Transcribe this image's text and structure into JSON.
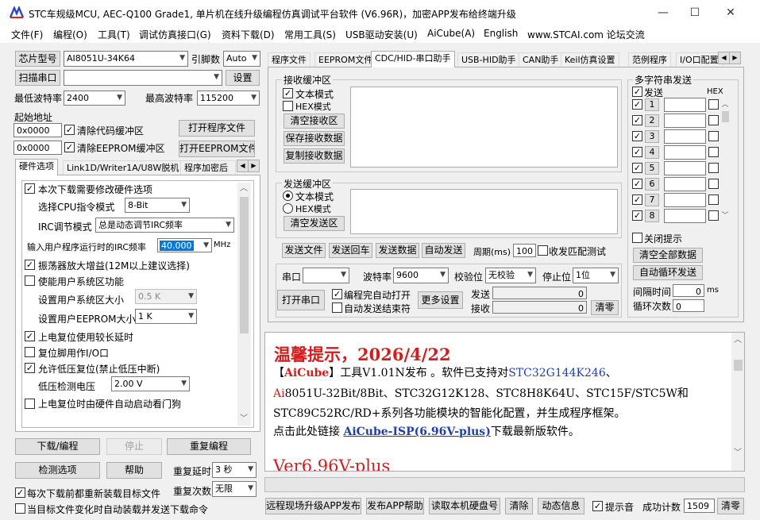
{
  "window": {
    "title": "STC车规级MCU, AEC-Q100 Grade1, 单片机在线升级编程仿真调试平台软件 (V6.96R)，加密APP发布给终端升级",
    "minimize": "—",
    "maximize": "☐",
    "close": "✕"
  },
  "menu": [
    "文件(F)",
    "编程(O)",
    "工具(T)",
    "调试仿真接口(G)",
    "资料下载(D)",
    "常用工具(S)",
    "USB驱动安装(U)",
    "AiCube(A)",
    "English",
    "www.STCAI.com 论坛交流"
  ],
  "left": {
    "chip_model_btn": "芯片型号",
    "chip_model_value": "AI8051U-34K64",
    "pin_count_label": "引脚数",
    "pin_count_value": "Auto",
    "scan_port_btn": "扫描串口",
    "port_value": "",
    "settings_btn": "设置",
    "min_baud_label": "最低波特率",
    "min_baud_value": "2400",
    "max_baud_label": "最高波特率",
    "max_baud_value": "115200",
    "start_addr_label": "起始地址",
    "addr1": "0x0000",
    "clear_code": "清除代码缓冲区",
    "open_prog": "打开程序文件",
    "addr2": "0x0000",
    "clear_eeprom": "清除EEPROM缓冲区",
    "open_eeprom": "打开EEPROM文件",
    "tabs": [
      "硬件选项",
      "Link1D/Writer1A/U8W脱机",
      "程序加密后"
    ],
    "hw": {
      "modify_hw": "本次下载需要修改硬件选项",
      "cpu_mode_label": "选择CPU指令模式",
      "cpu_mode_value": "8-Bit",
      "irc_mode_label": "IRC调节模式",
      "irc_mode_value": "总是动态调节IRC频率",
      "irc_freq_label": "输入用户程序运行时的IRC频率",
      "irc_freq_value": "40.000",
      "irc_unit": "MHz",
      "osc_gain": "振荡器放大增益(12M以上建议选择)",
      "sys_area": "使能用户系统区功能",
      "sys_area_size_label": "设置用户系统区大小",
      "sys_area_size_value": "0.5 K",
      "eeprom_size_label": "设置用户EEPROM大小",
      "eeprom_size_value": "1   K",
      "long_reset": "上电复位使用较长延时",
      "reset_io": "复位脚用作I/O口",
      "lvr": "允许低压复位(禁止低压中断)",
      "lvd_label": "低压检测电压",
      "lvd_value": "2.00 V",
      "wdt": "上电复位时由硬件自动启动看门狗"
    },
    "download_btn": "下载/编程",
    "stop_btn": "停止",
    "reprogram_btn": "重复编程",
    "check_btn": "检测选项",
    "help_btn": "帮助",
    "repeat_delay_label": "重复延时",
    "repeat_delay_value": "3 秒",
    "reload_cb": "每次下载前都重新装载目标文件",
    "repeat_count_label": "重复次数",
    "repeat_count_value": "无限",
    "auto_send_cb": "当目标文件变化时自动装载并发送下载命令"
  },
  "right": {
    "tabs": [
      "程序文件",
      "EEPROM文件",
      "CDC/HID-串口助手",
      "USB-HID助手",
      "CAN助手",
      "Keil仿真设置",
      "范例程序",
      "I/O口配置"
    ],
    "recv": {
      "title": "接收缓冲区",
      "text_mode": "文本模式",
      "hex_mode": "HEX模式",
      "clear": "清空接收区",
      "save": "保存接收数据",
      "copy": "复制接收数据"
    },
    "send": {
      "title": "发送缓冲区",
      "text_mode": "文本模式",
      "hex_mode": "HEX模式",
      "clear": "清空发送区"
    },
    "multi": {
      "title": "多字符串发送",
      "send_label": "发送",
      "hex_label": "HEX",
      "nums": [
        "1",
        "2",
        "3",
        "4",
        "5",
        "6",
        "7",
        "8"
      ],
      "close_tip": "关闭提示",
      "clear_all": "清空全部数据",
      "auto_loop": "自动循环发送",
      "interval_label": "间隔时间",
      "interval_value": "0",
      "interval_unit": "ms",
      "loop_label": "循环次数",
      "loop_value": "0"
    },
    "send_file": "发送文件",
    "send_return": "发送回车",
    "send_data": "发送数据",
    "auto_send": "自动发送",
    "period_label": "周期(ms)",
    "period_value": "100",
    "match_test": "收发匹配测试",
    "port_label": "串口",
    "port_value": "",
    "baud_label": "波特率",
    "baud_value": "9600",
    "parity_label": "校验位",
    "parity_value": "无校验",
    "stop_label": "停止位",
    "stop_value": "1位",
    "open_port": "打开串口",
    "auto_open": "编程完自动打开",
    "auto_end": "自动发送结束符",
    "more": "更多设置",
    "sent_label": "发送",
    "sent_value": "0",
    "recv_label": "接收",
    "recv_value": "0",
    "clear_count": "清零",
    "notice": {
      "title": "温馨提示，2026/4/22",
      "l1a": "【",
      "l1b": "AiCube",
      "l1c": "】工具V1.01N发布 。软件已支持对",
      "l1d": "STC32G144K246",
      "l1e": "、",
      "l2a": "Ai",
      "l2b": "8051U-32Bit/8Bit、STC32G12K128、STC8H8K64U、STC15F/STC5W和",
      "l3": "STC89C52RC/RD+系列各功能模块的智能化配置，并生成程序框架。",
      "l4a": "点击此处链接 ",
      "l4b": "AiCube-ISP(6.96V-plus)",
      "l4c": "下载最新版软件。",
      "l5": "Ver6.96V-plus"
    },
    "remote_btn": "远程现场升级APP发布",
    "publish_help": "发布APP帮助",
    "read_disk": "读取本机硬盘号",
    "clear_btn": "清除",
    "anim_btn": "动态信息",
    "beep": "提示音",
    "success_label": "成功计数",
    "success_value": "1509",
    "clear2": "清零"
  }
}
